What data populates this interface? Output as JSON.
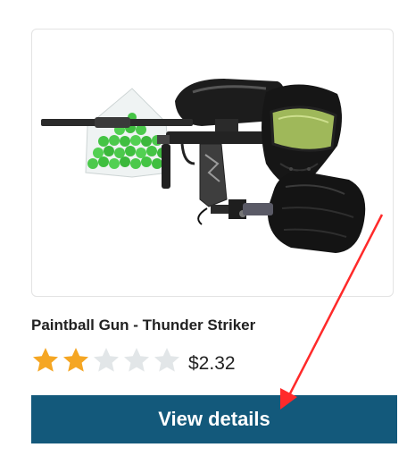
{
  "product": {
    "title": "Paintball Gun - Thunder Striker",
    "price": "$2.32",
    "rating": {
      "value": 2,
      "max": 5
    },
    "image_icon": "paintball-gun-product-image",
    "star_filled_color": "#f5a623",
    "star_empty_color": "#e2e6e8"
  },
  "actions": {
    "view_details_label": "View details",
    "button_color": "#13597b"
  },
  "annotation": {
    "arrow_color": "#ff2a2a",
    "arrow_icon": "red-arrow-pointing-to-button"
  }
}
